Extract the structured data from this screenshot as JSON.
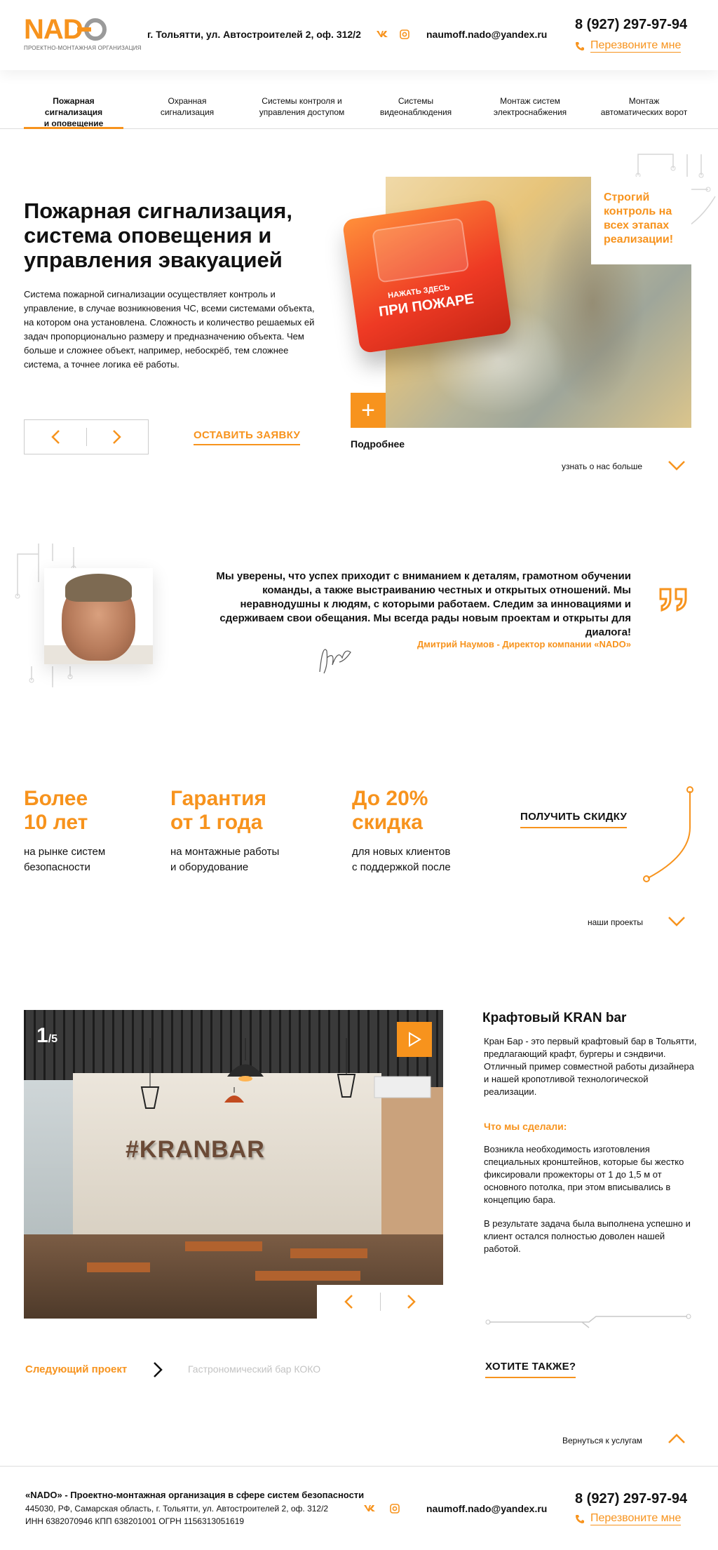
{
  "header": {
    "logo_text": "NADO",
    "logo_subtitle": "ПРОЕКТНО-МОНТАЖНАЯ ОРГАНИЗАЦИЯ",
    "address": "г. Тольятти, ул. Автостроителей 2, оф. 312/2",
    "social_vk": "vk",
    "social_ig": "ig",
    "email": "naumoff.nado@yandex.ru",
    "phone": "8 (927) 297-97-94",
    "callback": "Перезвоните мне"
  },
  "nav": {
    "items": [
      {
        "line1": "Пожарная сигнализация",
        "line2": "и оповещение"
      },
      {
        "line1": "Охранная",
        "line2": "сигнализация"
      },
      {
        "line1": "Системы контроля и",
        "line2": "управления доступом"
      },
      {
        "line1": "Системы",
        "line2": "видеонаблюдения"
      },
      {
        "line1": "Монтаж систем",
        "line2": "электроснабжения"
      },
      {
        "line1": "Монтаж",
        "line2": "автоматических ворот"
      }
    ]
  },
  "hero": {
    "title": "Пожарная сигнализация, система оповещения и управления эвакуацией",
    "text": "Система пожарной сигнализации осуществляет контроль и управление, в случае возникновения ЧС, всеми системами объекта, на котором она установлена. Сложность и количество решаемых ей задач пропорционально размеру и предназначению объекта. Чем больше и сложнее объект, например, небоскрёб, тем сложнее система, а точнее логика её работы.",
    "leave_request": "ОСТАВИТЬ ЗАЯВКУ",
    "card_text": "Строгий контроль на всех этапах реализации!",
    "device_label_small": "НАЖАТЬ ЗДЕСЬ",
    "device_label_big": "ПРИ ПОЖАРЕ",
    "more": "Подробнее",
    "learn_more": "узнать о нас больше"
  },
  "quote": {
    "text": "Мы уверены, что успех приходит с вниманием к деталям, грамотном обучении команды, а также выстраиванию честных и открытых отношений. Мы неравнодушны к людям, с которыми работаем. Следим за инновациями и сдерживаем свои обещания. Мы всегда рады новым проектам и открыты для диалога!",
    "author": "Дмитрий Наумов - Директор компании «NADO»",
    "marks": "”"
  },
  "stats": {
    "items": [
      {
        "big1": "Более",
        "big2": "10 лет",
        "small1": "на рынке систем",
        "small2": "безопасности"
      },
      {
        "big1": "Гарантия",
        "big2": "от 1 года",
        "small1": "на монтажные работы",
        "small2": "и оборудование"
      },
      {
        "big1": "До 20%",
        "big2": "скидка",
        "small1": "для новых клиентов",
        "small2": "с поддержкой после"
      }
    ],
    "get_discount": "ПОЛУЧИТЬ СКИДКУ",
    "our_projects": "наши проекты"
  },
  "project": {
    "counter_current": "1",
    "counter_total": "/5",
    "sign": "#KRANBAR",
    "title": "Крафтовый KRAN bar",
    "desc": "Кран Бар - это первый крафтовый бар в Тольятти, предлагающий крафт, бургеры и сэндвичи. Отличный пример совместной работы дизайнера и нашей кропотливой технологической реализации.",
    "what_label": "Что мы сделали:",
    "detail1": "Возникла необходимость изготовления специальных кронштейнов, которые бы жестко фиксировали прожекторы от 1 до 1,5 м от основного потолка, при этом вписывались в концепцию бара.",
    "detail2": "В результате задача была выполнена успешно и клиент остался полностью доволен нашей работой.",
    "next_label": "Следующий проект",
    "next_name": "Гастрономический бар КОКО",
    "want_also": "ХОТИТЕ ТАКЖЕ?",
    "back": "Вернуться к услугам"
  },
  "footer": {
    "title": "«NADO» - Проектно-монтажная организация в сфере систем безопасности",
    "address": "445030, РФ, Самарская область, г. Тольятти, ул. Автостроителей 2, оф. 312/2",
    "inn": "ИНН 6382070946  КПП 638201001 ОГРН 1156313051619",
    "email": "naumoff.nado@yandex.ru",
    "phone": "8 (927) 297-97-94",
    "callback": "Перезвоните мне"
  },
  "colors": {
    "accent": "#f7931d",
    "text": "#111111",
    "muted": "#c3c3c3"
  }
}
